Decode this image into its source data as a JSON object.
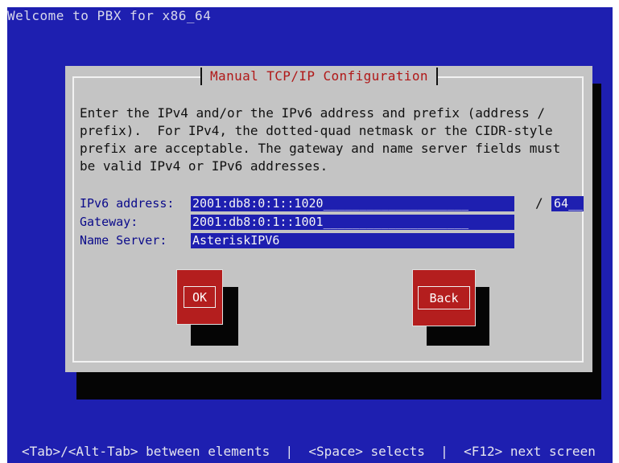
{
  "screen": {
    "top_text": "Welcome to PBX for x86_64",
    "bottom_text": "<Tab>/<Alt-Tab> between elements  |  <Space> selects  |  <F12> next screen"
  },
  "dialog": {
    "title": "Manual TCP/IP Configuration",
    "description": "Enter the IPv4 and/or the IPv6 address and prefix (address /\nprefix).  For IPv4, the dotted-quad netmask or the CIDR-style\nprefix are acceptable. The gateway and name server fields must\nbe valid IPv4 or IPv6 addresses.",
    "fields": {
      "ipv6_address": {
        "label": "IPv6 address:",
        "value": "2001:db8:0:1::1020",
        "fill": "____________________"
      },
      "prefix": {
        "separator": "/",
        "value": "64",
        "fill": "__"
      },
      "gateway": {
        "label": "Gateway:",
        "value": "2001:db8:0:1::1001",
        "fill": "____________________"
      },
      "name_server": {
        "label": "Name Server:",
        "value": "AsteriskIPV6",
        "fill": ""
      }
    },
    "buttons": {
      "ok": "OK",
      "back": "Back"
    }
  },
  "colors": {
    "background": "#1e1fb0",
    "dialog": "#c4c4c4",
    "title": "#b01818",
    "button": "#b41e1e",
    "label": "#0a0a8a"
  }
}
